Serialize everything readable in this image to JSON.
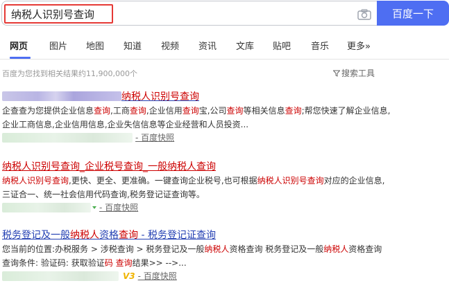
{
  "search": {
    "query": "纳税人识别号查询",
    "button_label": "百度一下"
  },
  "tabs": [
    {
      "label": "网页"
    },
    {
      "label": "图片"
    },
    {
      "label": "地图"
    },
    {
      "label": "知道"
    },
    {
      "label": "视频"
    },
    {
      "label": "资讯"
    },
    {
      "label": "文库"
    },
    {
      "label": "贴吧"
    },
    {
      "label": "音乐"
    },
    {
      "label": "更多»"
    }
  ],
  "stats": {
    "text": "百度为您找到相关结果约11,900,000个",
    "tools_label": "搜索工具"
  },
  "results": [
    {
      "title_hl": "纳税人识别号查询",
      "abstract": [
        {
          "t": "企查查为您提供企业信息",
          "h": false
        },
        {
          "t": "查询",
          "h": true
        },
        {
          "t": ",工商",
          "h": false
        },
        {
          "t": "查询",
          "h": true
        },
        {
          "t": ",企业信用",
          "h": false
        },
        {
          "t": "查询",
          "h": true
        },
        {
          "t": "宝,公司",
          "h": false
        },
        {
          "t": "查询",
          "h": true
        },
        {
          "t": "等相关信息",
          "h": false
        },
        {
          "t": "查询",
          "h": true
        },
        {
          "t": ";帮您快速了解企业信息,企业工商信息,企业信用信息,企业失信信息等企业经营和人员投资...",
          "h": false
        }
      ],
      "snapshot": "- 百度快照"
    },
    {
      "title": "纳税人识别号查询_企业税号查询_一般纳税人查询",
      "abstract": [
        {
          "t": "纳税人识别号查询",
          "h": true
        },
        {
          "t": ",更快、更全、更准确。一键查询企业税号,也可根据",
          "h": false
        },
        {
          "t": "纳税人识别号查询",
          "h": true
        },
        {
          "t": "对应的企业信息,三证合一、统一社会信用代码查询,税务登记证查询等。",
          "h": false
        }
      ],
      "snapshot": "- 百度快照"
    },
    {
      "title_parts": [
        {
          "t": "税务登记及一般",
          "h": false
        },
        {
          "t": "纳税人",
          "h": true
        },
        {
          "t": "资格",
          "h": false
        },
        {
          "t": "查询",
          "h": true
        },
        {
          "t": " - 税务登记证查询",
          "h": false
        }
      ],
      "abstract": [
        {
          "t": "您当前的位置:办税服务 > 涉税查询 > 税务登记及一般",
          "h": false
        },
        {
          "t": "纳税人",
          "h": true
        },
        {
          "t": "资格查询 税务登记及一般",
          "h": false
        },
        {
          "t": "纳税人",
          "h": true
        },
        {
          "t": "资格查询 查询条件: 验证码: 获取验证",
          "h": false
        },
        {
          "t": "码",
          "h": true
        },
        {
          "t": " ",
          "h": false
        },
        {
          "t": "查询",
          "h": true
        },
        {
          "t": "结果>> -->...",
          "h": false
        }
      ],
      "badge": "V3",
      "snapshot": "- 百度快照"
    }
  ]
}
